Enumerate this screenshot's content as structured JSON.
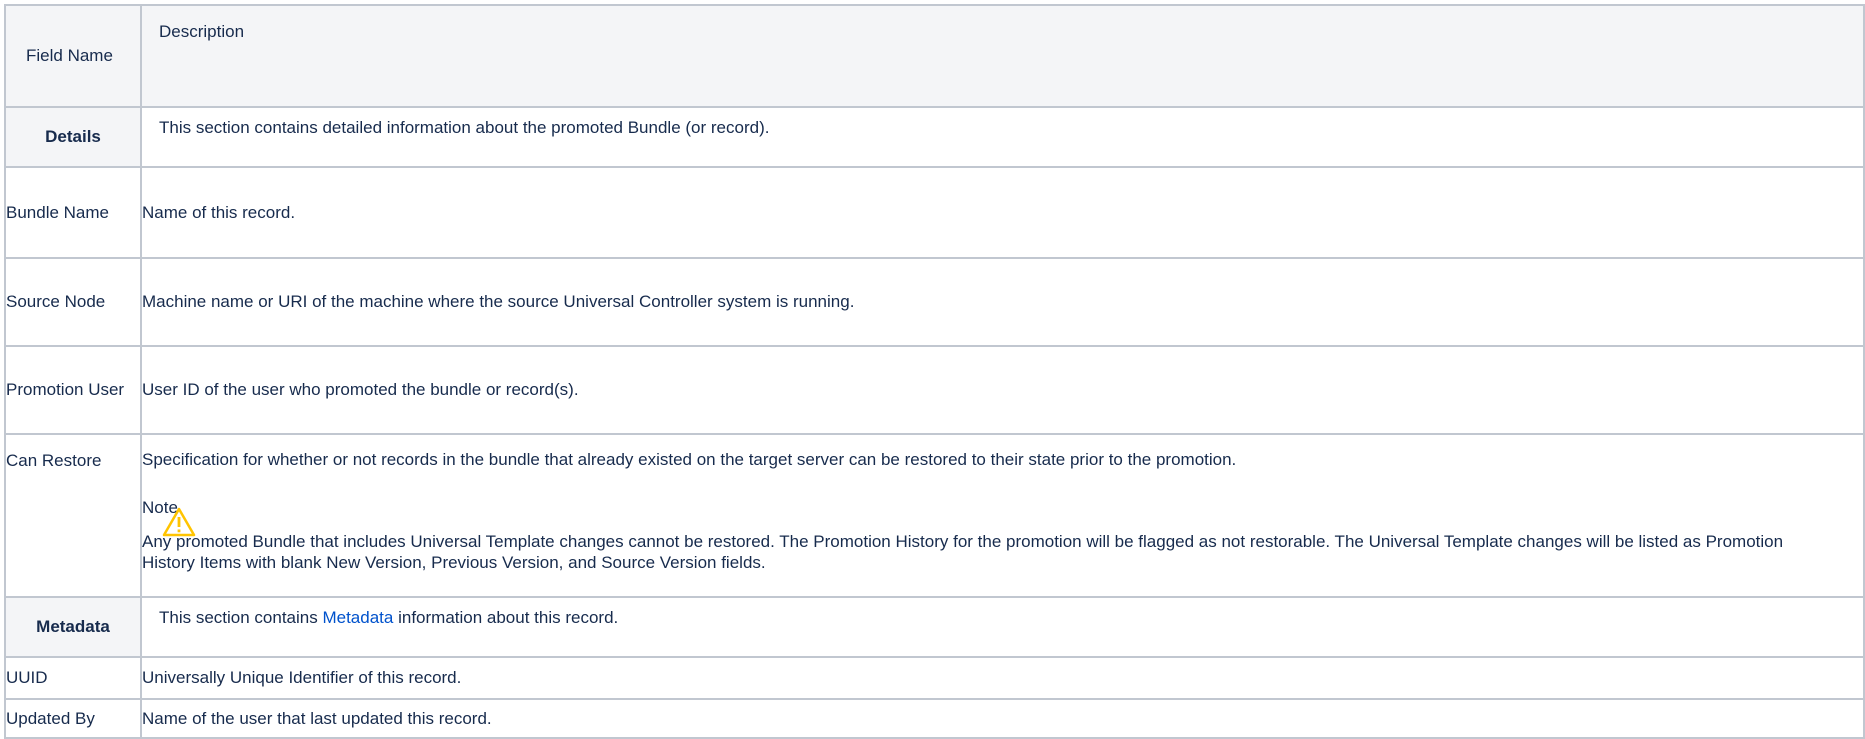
{
  "header": {
    "field_name": "Field Name",
    "description": "Description"
  },
  "rows": {
    "details": {
      "name": "Details",
      "desc": "This section contains detailed information about the promoted Bundle (or record)."
    },
    "bundle_name": {
      "name": "Bundle Name",
      "desc": "Name of this record."
    },
    "source_node": {
      "name": "Source Node",
      "desc": "Machine name or URI of the machine where the source Universal Controller system is running."
    },
    "promotion_user": {
      "name": "Promotion User",
      "desc": "User ID of the user who promoted the bundle or record(s)."
    },
    "can_restore": {
      "name": "Can Restore",
      "desc": "Specification for whether or not records in the bundle that already existed on the target server can be restored to their state prior to the promotion.",
      "note_title": "Note",
      "note_icon": "warning-icon",
      "note_color": "#ffc400",
      "note_body": "Any promoted Bundle that includes Universal Template changes cannot be restored. The Promotion History for the promotion will be flagged as not restorable. The Universal Template changes will be listed as Promotion History Items with blank New Version, Previous Version, and Source Version fields."
    },
    "metadata": {
      "name": "Metadata",
      "desc_before": "This section contains ",
      "desc_link": "Metadata",
      "desc_after": " information about this record.",
      "link_color": "#0052cc"
    },
    "uuid": {
      "name": "UUID",
      "desc": "Universally Unique Identifier of this record."
    },
    "updated_by": {
      "name": "Updated By",
      "desc": "Name of the user that last updated this record."
    }
  },
  "colors": {
    "border": "#c1c7d0",
    "header_bg": "#f4f5f7",
    "text": "#172b4d"
  }
}
